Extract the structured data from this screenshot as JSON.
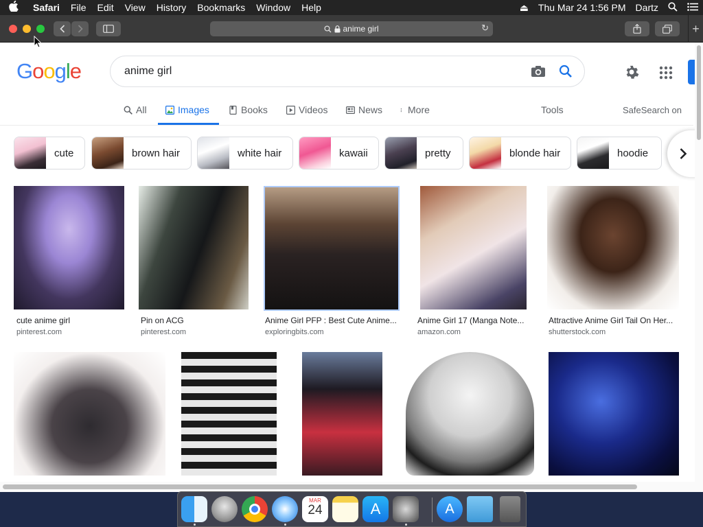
{
  "menubar": {
    "apple": "",
    "app_name": "Safari",
    "menus": [
      "File",
      "Edit",
      "View",
      "History",
      "Bookmarks",
      "Window",
      "Help"
    ],
    "clock": "Thu Mar 24  1:56 PM",
    "user": "Dartz"
  },
  "safari": {
    "url": "anime girl"
  },
  "google": {
    "query": "anime girl",
    "tabs": {
      "all": "All",
      "images": "Images",
      "books": "Books",
      "videos": "Videos",
      "news": "News",
      "more": "More",
      "tools": "Tools",
      "safesearch": "SafeSearch on"
    },
    "chips": [
      "cute",
      "brown hair",
      "white hair",
      "kawaii",
      "pretty",
      "blonde hair",
      "hoodie"
    ],
    "results_row1": [
      {
        "title": "cute anime girl",
        "source": "pinterest.com"
      },
      {
        "title": "Pin on ACG",
        "source": "pinterest.com"
      },
      {
        "title": "Anime Girl PFP : Best Cute Anime...",
        "source": "exploringbits.com"
      },
      {
        "title": "Anime Girl 17 (Manga Note...",
        "source": "amazon.com"
      },
      {
        "title": "Attractive Anime Girl Tail On Her...",
        "source": "shutterstock.com"
      }
    ]
  },
  "dock": {
    "calendar_month": "MAR",
    "calendar_day": "24"
  },
  "colors": {
    "google_blue": "#4285f4",
    "google_red": "#ea4335",
    "google_yellow": "#fbbc05",
    "google_green": "#34a853",
    "link_blue": "#1a73e8"
  }
}
